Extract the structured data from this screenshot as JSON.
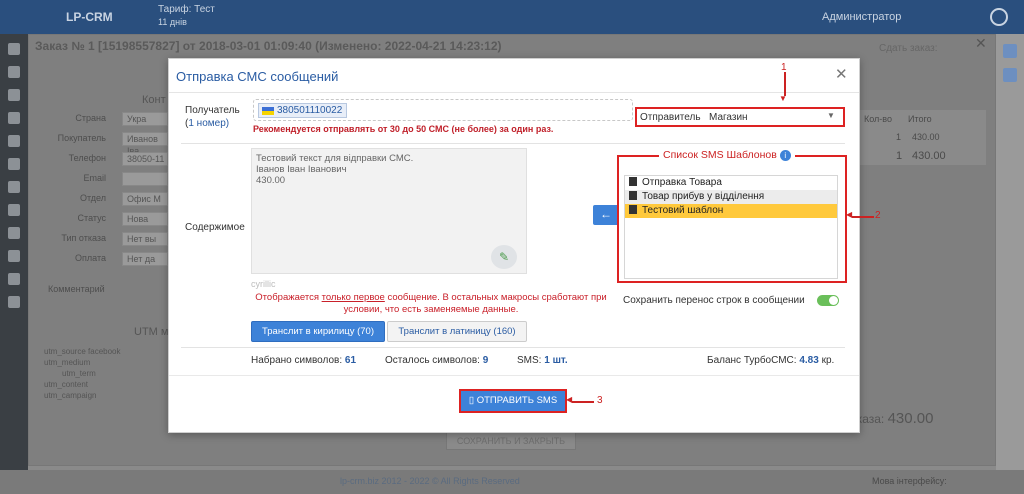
{
  "app": {
    "name": "LP-CRM",
    "tariff": "Тариф: Тест",
    "tariff_days": "11 днів",
    "admin": "Администратор"
  },
  "bg_window": {
    "title": "Заказ № 1 [15198557827] от 2018-03-01 01:09:40 (Изменено: 2022-04-21 14:23:12)",
    "can_save": "Сдать заказ:",
    "contacts_header": "Конт",
    "form_labels": [
      "Страна",
      "Покупатель",
      "Телефон",
      "Email",
      "Отдел",
      "Статус",
      "Тип отказа",
      "Оплата"
    ],
    "form_values": [
      "Укра",
      "Иванов Іва",
      "38050-11",
      "",
      "Офис М",
      "Нова",
      "Нет вы",
      "Нет да"
    ],
    "comment_label": "Комментарий",
    "utm_header": "UTM м",
    "utm": [
      {
        "k": "utm_source",
        "v": "facebook"
      },
      {
        "k": "utm_medium",
        "v": ""
      },
      {
        "k": "utm_term",
        "v": ""
      },
      {
        "k": "utm_content",
        "v": ""
      },
      {
        "k": "utm_campaign",
        "v": ""
      }
    ],
    "table_headers": [
      "Кол-во",
      "Итого"
    ],
    "row1": [
      "1",
      "430.00"
    ],
    "row2": [
      "1",
      "430.00"
    ],
    "total_label": "аказа:",
    "total_value": "430.00",
    "save_close": "СОХРАНИТЬ И ЗАКРЫТЬ"
  },
  "footer": {
    "copyright": "lp-crm.biz 2012 - 2022 © All Rights Reserved",
    "mine": "Мова інтерфейсу:"
  },
  "modal": {
    "title": "Отправка СМС сообщений",
    "recipient_label": "Получатель",
    "recipient_count_num": "1",
    "recipient_count_text": " номер)",
    "recipient_phone": "380501110022",
    "warning": "Рекомендуется отправлять от 30 до 50 СМС (не более) за один раз.",
    "sender_label": "Отправитель",
    "sender_value": "Магазин",
    "content_label": "Содержимое",
    "message_lines": [
      "Тестовий текст для відправки СМС.",
      "Іванов Іван Іванович",
      "430.00"
    ],
    "encoding": "cyrillic",
    "note_pre": "Отображается ",
    "note_link": "только первое",
    "note_post": " сообщение. В остальных макросы сработают при условии, что есть заменяемые данные.",
    "translit_cyr": "Транслит в кирилицу (70)",
    "translit_lat": "Транслит в латиницу (160)",
    "templates_title": "Список SMS Шаблонов",
    "templates": [
      "Отправка Товара",
      "Товар прибув у відділення",
      "Тестовий шаблон"
    ],
    "selected_template": 2,
    "save_linebreaks": "Сохранить перенос строк в сообщении",
    "typed_label": "Набрано символов:",
    "typed_value": "61",
    "left_label": "Осталось символов:",
    "left_value": "9",
    "sms_label": "SMS:",
    "sms_value": "1 шт.",
    "balance_label": "Баланс ТурбоСМС:",
    "balance_value": "4.83",
    "balance_unit": "кр.",
    "send_button": "ОТПРАВИТЬ SMS"
  },
  "annotations": [
    "1",
    "2",
    "3"
  ],
  "colors": {
    "accent": "#3d82d8",
    "highlight": "#ffc93c",
    "alert": "#dd2222"
  }
}
